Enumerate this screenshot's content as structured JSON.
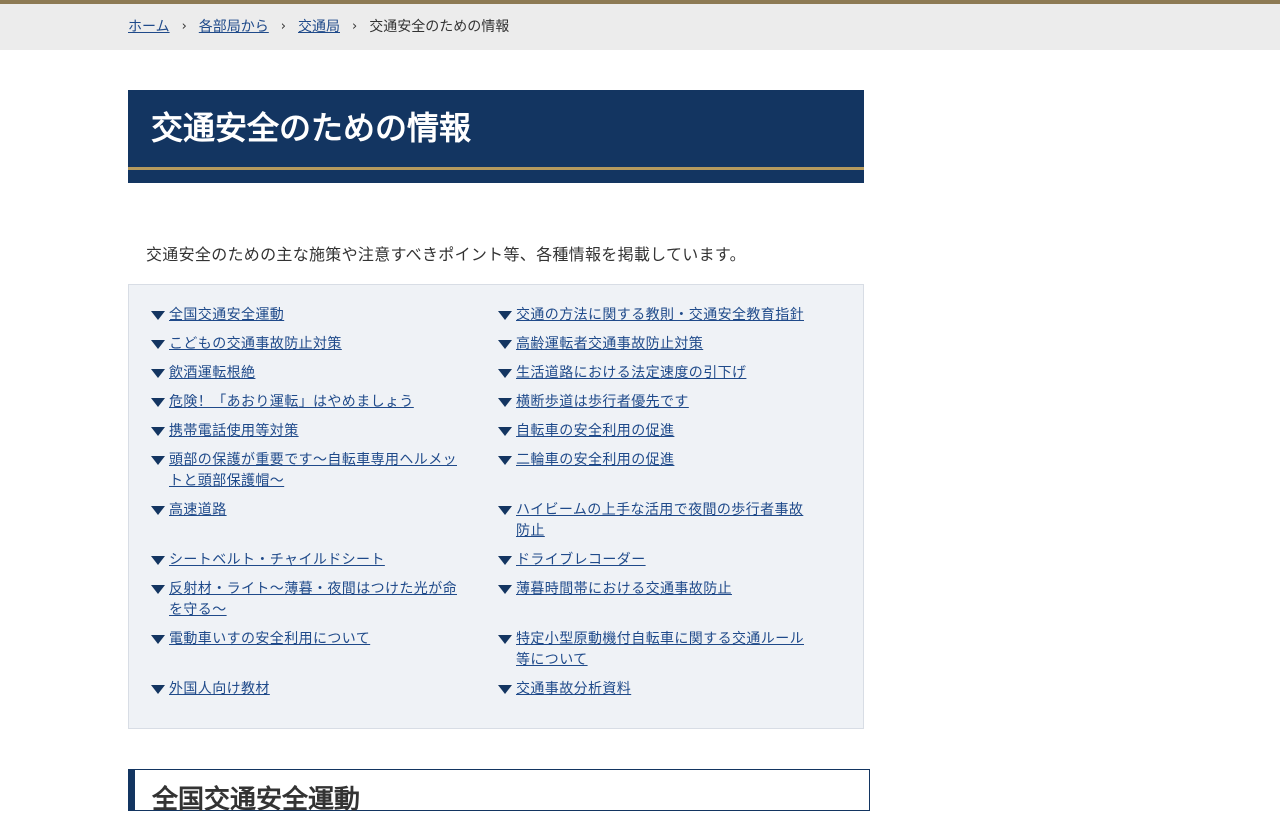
{
  "breadcrumb": {
    "items": [
      "ホーム",
      "各部局から",
      "交通局"
    ],
    "current": "交通安全のための情報"
  },
  "page": {
    "title": "交通安全のための情報",
    "intro": "交通安全のための主な施策や注意すべきポイント等、各種情報を掲載しています。"
  },
  "links": {
    "left": [
      "全国交通安全運動",
      "こどもの交通事故防止対策",
      "飲酒運転根絶",
      "危険！「あおり運転」はやめましょう",
      "携帯電話使用等対策",
      "頭部の保護が重要です～自転車専用ヘルメットと頭部保護帽～",
      "高速道路",
      "シートベルト・チャイルドシート",
      "反射材・ライト～薄暮・夜間はつけた光が命を守る～",
      "電動車いすの安全利用について",
      "外国人向け教材"
    ],
    "right": [
      "交通の方法に関する教則・交通安全教育指針",
      "高齢運転者交通事故防止対策",
      "生活道路における法定速度の引下げ",
      "横断歩道は歩行者優先です",
      "自転車の安全利用の促進",
      "二輪車の安全利用の促進",
      "ハイビームの上手な活用で夜間の歩行者事故防止",
      "ドライブレコーダー",
      "薄暮時間帯における交通事故防止",
      "特定小型原動機付自転車に関する交通ルール等について",
      "交通事故分析資料"
    ]
  },
  "section": {
    "heading": "全国交通安全運動"
  },
  "colors": {
    "navy": "#133561",
    "gold": "#b59a5e",
    "link": "#1f4a8a",
    "panel_bg": "#eff2f6",
    "breadcrumb_bg": "#ececec"
  },
  "icons": {
    "breadcrumb_separator": "chevron-right-icon",
    "link_marker": "triangle-down-icon"
  }
}
